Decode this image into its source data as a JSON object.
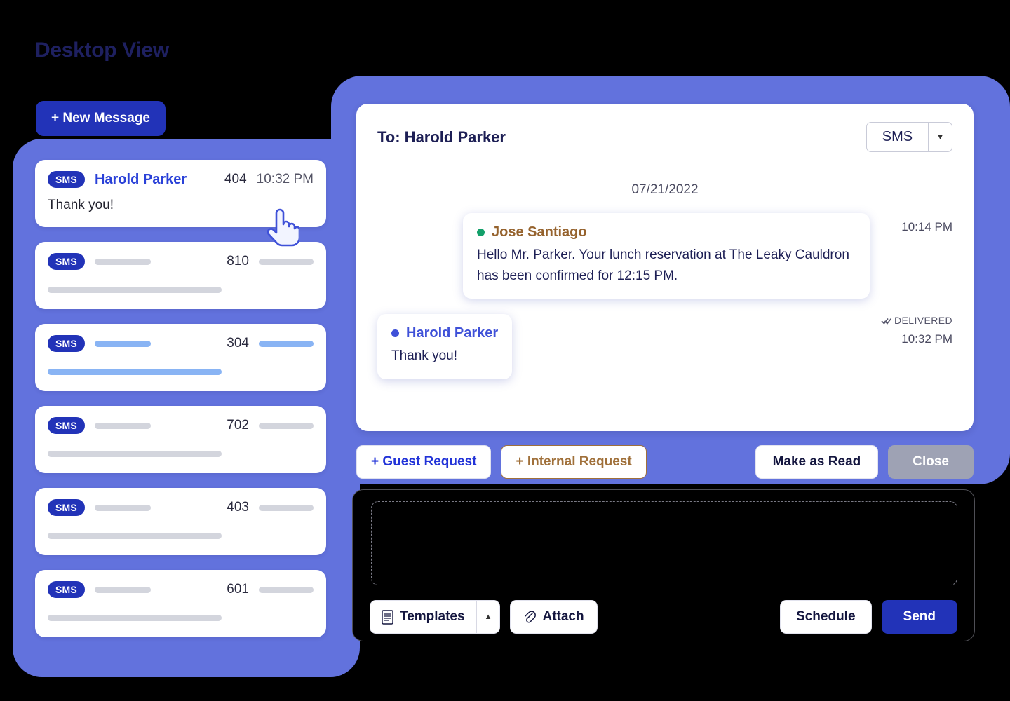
{
  "page": {
    "title": "Desktop View"
  },
  "sidebar": {
    "new_message_label": "+ New Message",
    "conversations": [
      {
        "badge": "SMS",
        "name": "Harold Parker",
        "number": "404",
        "time": "10:32 PM",
        "preview": "Thank you!",
        "placeholder": false,
        "highlight": false
      },
      {
        "badge": "SMS",
        "number": "810",
        "placeholder": true,
        "highlight": false
      },
      {
        "badge": "SMS",
        "number": "304",
        "placeholder": true,
        "highlight": true
      },
      {
        "badge": "SMS",
        "number": "702",
        "placeholder": true,
        "highlight": false
      },
      {
        "badge": "SMS",
        "number": "403",
        "placeholder": true,
        "highlight": false
      },
      {
        "badge": "SMS",
        "number": "601",
        "placeholder": true,
        "highlight": false
      }
    ]
  },
  "conversation": {
    "to_label": "To: Harold Parker",
    "channel_selected": "SMS",
    "date_separator": "07/21/2022",
    "messages": [
      {
        "sender": "Jose Santiago",
        "text": "Hello Mr. Parker. Your lunch reservation at The Leaky Cauldron has been confirmed for 12:15 PM.",
        "time": "10:14 PM",
        "status": "DELIVERED",
        "direction": "in",
        "dot_color": "#13a06a",
        "name_color": "#96632e"
      },
      {
        "sender": "Harold Parker",
        "text": "Thank you!",
        "time": "10:32 PM",
        "status": "",
        "direction": "out",
        "dot_color": "#3f51d8",
        "name_color": "#3f51d8"
      }
    ]
  },
  "actions": {
    "guest_request": "+ Guest Request",
    "internal_request": "+ Internal Request",
    "make_as_read": "Make as Read",
    "close": "Close"
  },
  "compose": {
    "templates": "Templates",
    "attach": "Attach",
    "schedule": "Schedule",
    "send": "Send",
    "body_value": ""
  },
  "colors": {
    "panel_purple": "#6272dd",
    "brand_blue": "#2233b8",
    "accent_blue": "#2a41d8",
    "light_blue_bar": "#89b4f4",
    "grey_bar": "#d3d5dd",
    "brown": "#a0703a",
    "green": "#13a06a",
    "close_grey": "#9ea2b4"
  }
}
